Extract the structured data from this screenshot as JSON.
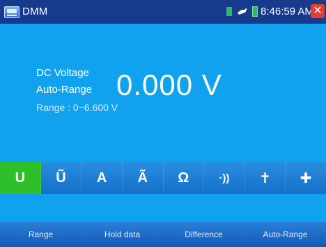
{
  "titlebar": {
    "app_title": "DMM",
    "time": "8:46:59 AM",
    "close_glyph": "✕"
  },
  "display": {
    "mode_label": "DC Voltage",
    "range_mode_label": "Auto-Range",
    "range_label": "Range : 0~6.600 V",
    "reading": "0.000 V"
  },
  "mode_buttons": [
    {
      "icon": "dc-voltage-icon",
      "glyph": "U",
      "active": true
    },
    {
      "icon": "ac-voltage-icon",
      "glyph": "Ũ",
      "active": false
    },
    {
      "icon": "dc-current-icon",
      "glyph": "A",
      "active": false
    },
    {
      "icon": "ac-current-icon",
      "glyph": "Ã",
      "active": false
    },
    {
      "icon": "resistance-icon",
      "glyph": "Ω",
      "active": false
    },
    {
      "icon": "continuity-icon",
      "glyph": "·))",
      "active": false
    },
    {
      "icon": "diode-icon",
      "glyph": "✝",
      "active": false
    },
    {
      "icon": "capacitor-icon",
      "glyph": "✚",
      "active": false
    }
  ],
  "softkeys": [
    "Range",
    "Hold data",
    "Difference",
    "Auto-Range"
  ],
  "colors": {
    "titlebar_bg": "#173a8c",
    "screen_bg": "#11a2ef",
    "active_mode": "#2fbf2a",
    "close_button": "#e53d2f"
  }
}
